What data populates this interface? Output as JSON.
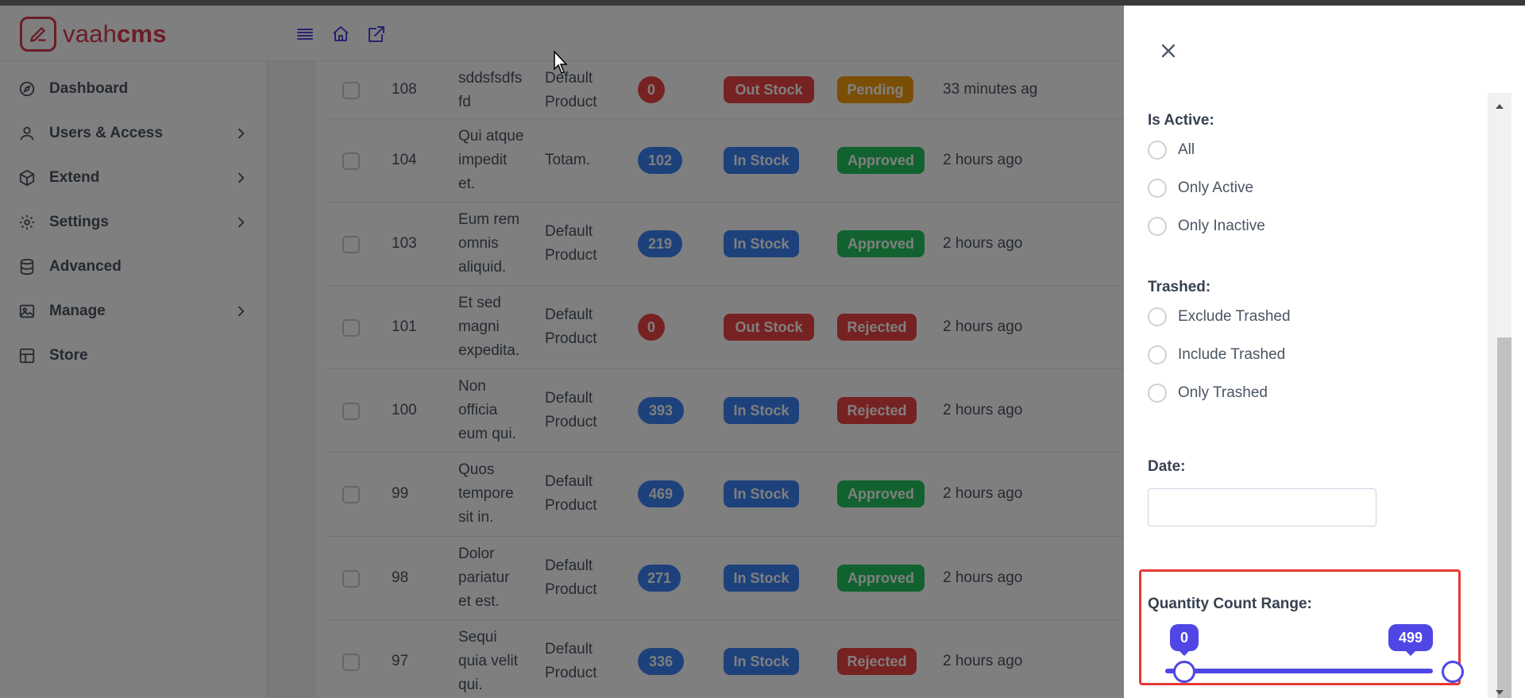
{
  "app": {
    "logo_plain": "vaah",
    "logo_bold": "cms"
  },
  "header_icons": [
    "menu-icon",
    "home-icon",
    "external-link-icon"
  ],
  "sidebar": {
    "items": [
      {
        "label": "Dashboard",
        "icon": "compass-icon",
        "has_children": false
      },
      {
        "label": "Users & Access",
        "icon": "user-icon",
        "has_children": true
      },
      {
        "label": "Extend",
        "icon": "box-icon",
        "has_children": true
      },
      {
        "label": "Settings",
        "icon": "gear-icon",
        "has_children": true
      },
      {
        "label": "Advanced",
        "icon": "database-icon",
        "has_children": false
      },
      {
        "label": "Manage",
        "icon": "image-icon",
        "has_children": true
      },
      {
        "label": "Store",
        "icon": "grid-icon",
        "has_children": false
      }
    ]
  },
  "table": {
    "rows": [
      {
        "id": "108",
        "name": [
          "sddsfsdfs",
          "fd"
        ],
        "type": [
          "Default",
          "Product"
        ],
        "qty": "0",
        "stock": "Out Stock",
        "status": "Pending",
        "time": "33 minutes ag"
      },
      {
        "id": "104",
        "name": [
          "Qui atque",
          "impedit",
          "et."
        ],
        "type": [
          "Totam."
        ],
        "qty": "102",
        "stock": "In Stock",
        "status": "Approved",
        "time": "2 hours ago"
      },
      {
        "id": "103",
        "name": [
          "Eum rem",
          "omnis",
          "aliquid."
        ],
        "type": [
          "Default",
          "Product"
        ],
        "qty": "219",
        "stock": "In Stock",
        "status": "Approved",
        "time": "2 hours ago"
      },
      {
        "id": "101",
        "name": [
          "Et sed",
          "magni",
          "expedita."
        ],
        "type": [
          "Default",
          "Product"
        ],
        "qty": "0",
        "stock": "Out Stock",
        "status": "Rejected",
        "time": "2 hours ago"
      },
      {
        "id": "100",
        "name": [
          "Non",
          "officia",
          "eum qui."
        ],
        "type": [
          "Default",
          "Product"
        ],
        "qty": "393",
        "stock": "In Stock",
        "status": "Rejected",
        "time": "2 hours ago"
      },
      {
        "id": "99",
        "name": [
          "Quos",
          "tempore",
          "sit in."
        ],
        "type": [
          "Default",
          "Product"
        ],
        "qty": "469",
        "stock": "In Stock",
        "status": "Approved",
        "time": "2 hours ago"
      },
      {
        "id": "98",
        "name": [
          "Dolor",
          "pariatur",
          "et est."
        ],
        "type": [
          "Default",
          "Product"
        ],
        "qty": "271",
        "stock": "In Stock",
        "status": "Approved",
        "time": "2 hours ago"
      },
      {
        "id": "97",
        "name": [
          "Sequi",
          "quia velit",
          "qui."
        ],
        "type": [
          "Default",
          "Product"
        ],
        "qty": "336",
        "stock": "In Stock",
        "status": "Rejected",
        "time": "2 hours ago"
      }
    ]
  },
  "colors": {
    "brand": "#d73a50",
    "qty_positive": "#3b82f6",
    "qty_zero": "#ef4444",
    "in_stock": "#3b82f6",
    "out_stock": "#ef4444",
    "approved": "#22c55e",
    "pending": "#f59e0b",
    "rejected": "#ef4444",
    "slider": "#4f46e5",
    "highlight": "#e53935"
  },
  "filters": {
    "is_active": {
      "title": "Is Active:",
      "options": [
        "All",
        "Only Active",
        "Only Inactive"
      ]
    },
    "trashed": {
      "title": "Trashed:",
      "options": [
        "Exclude Trashed",
        "Include Trashed",
        "Only Trashed"
      ]
    },
    "date": {
      "title": "Date:",
      "value": ""
    },
    "quantity_range": {
      "title": "Quantity Count Range:",
      "min": "0",
      "max": "499"
    }
  }
}
